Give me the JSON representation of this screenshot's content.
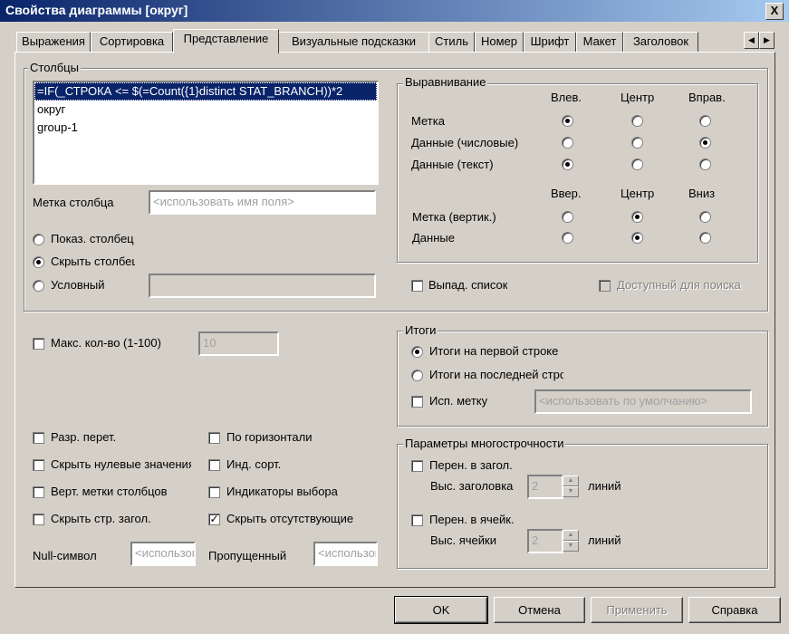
{
  "window": {
    "title": "Свойства диаграммы [округ]",
    "close_glyph": "X"
  },
  "tabs": [
    "Выражения",
    "Сортировка",
    "Представление",
    "Визуальные подсказки",
    "Стиль",
    "Номер",
    "Шрифт",
    "Макет",
    "Заголовок"
  ],
  "active_tab": "Представление",
  "columns": {
    "group_title": "Столбцы",
    "items": [
      "=IF(_СТРОКА <= $(=Count({1}distinct STAT_BRANCH))*2",
      "округ",
      "group-1"
    ],
    "selected_index": 0,
    "label_caption": "Метка столбца",
    "label_placeholder": "<использовать имя поля>",
    "show_column": "Показ. столбец",
    "hide_column": "Скрыть столбец",
    "conditional": "Условный",
    "selected_visibility": "hide"
  },
  "alignment": {
    "group_title": "Выравнивание",
    "h_headers": [
      "Влев.",
      "Центр",
      "Вправ."
    ],
    "h_rows": [
      {
        "label": "Метка",
        "selected": 0
      },
      {
        "label": "Данные (числовые)",
        "selected": 2
      },
      {
        "label": "Данные (текст)",
        "selected": 0
      }
    ],
    "v_headers": [
      "Ввер.",
      "Центр",
      "Вниз"
    ],
    "v_rows": [
      {
        "label": "Метка (вертик.)",
        "selected": 1
      },
      {
        "label": "Данные",
        "selected": 1
      }
    ]
  },
  "dropdown_list": {
    "label": "Выпад. список",
    "checked": false
  },
  "search_available": {
    "label": "Доступный для поиска",
    "checked": false,
    "disabled": true
  },
  "max_count": {
    "label": "Макс. кол-во (1-100)",
    "value": "10",
    "checked": false
  },
  "totals": {
    "group_title": "Итоги",
    "first_row": "Итоги на первой строке",
    "last_row": "Итоги на последней строке",
    "selected": "first",
    "use_label": "Исп. метку",
    "use_label_placeholder": "<использовать по умолчанию>"
  },
  "options_left": [
    {
      "label": "Разр. перет.",
      "checked": false
    },
    {
      "label": "Скрыть нулевые значения",
      "checked": false
    },
    {
      "label": "Верт. метки столбцов",
      "checked": false
    },
    {
      "label": "Скрыть стр. загол.",
      "checked": false
    }
  ],
  "options_right": [
    {
      "label": "По горизонтали",
      "checked": false
    },
    {
      "label": "Инд. сорт.",
      "checked": false
    },
    {
      "label": "Индикаторы выбора",
      "checked": false
    },
    {
      "label": "Скрыть отсутствующие",
      "checked": true
    }
  ],
  "null_symbol": {
    "label": "Null-символ",
    "placeholder": "<использовать по умолчанию>"
  },
  "missing": {
    "label": "Пропущенный",
    "placeholder": "<использовать по умолчанию>"
  },
  "multiline": {
    "group_title": "Параметры многострочности",
    "wrap_header": "Перен. в загол.",
    "header_height": "Выс. заголовка",
    "header_value": "2",
    "wrap_cell": "Перен. в ячейк.",
    "cell_height": "Выс. ячейки",
    "cell_value": "2",
    "lines": "линий"
  },
  "buttons": {
    "ok": "OK",
    "cancel": "Отмена",
    "apply": "Применить",
    "help": "Справка"
  }
}
